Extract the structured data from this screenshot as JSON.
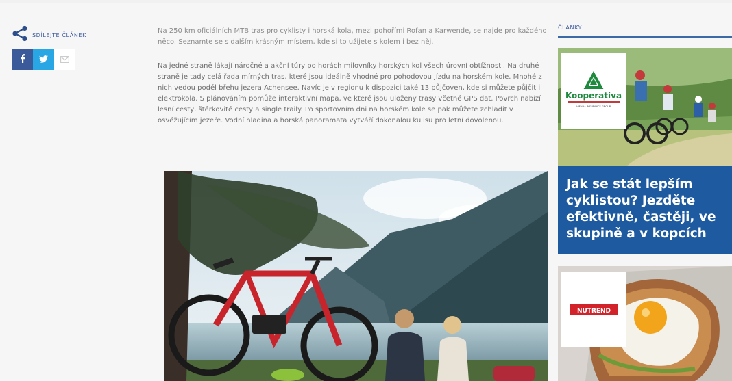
{
  "share": {
    "label": "SDÍLEJTE ČLÁNEK",
    "icons": [
      "share-icon",
      "facebook-icon",
      "twitter-icon",
      "mail-icon"
    ],
    "facebook_color": "#3b5a9a",
    "twitter_color": "#29a7e4"
  },
  "article": {
    "paragraph1": "Na 250 km oficiálních MTB tras pro cyklisty i horská kola, mezi pohořími Rofan a Karwende, se najde pro každého něco. Seznamte se s dalším krásným místem, kde si to užijete s kolem i bez něj.",
    "paragraph2": "Na jedné straně lákají náročné a akční túry po horách milovníky horských kol všech úrovní obtížnosti. Na druhé straně je tady celá řada mírných tras, které jsou ideálně vhodné pro pohodovou jízdu na horském kole. Mnohé z nich vedou podél břehu jezera Achensee. Navíc je v regionu k dispozici také 13 půjčoven, kde si můžete půjčit i elektrokola. S plánováním pomůže interaktivní mapa, ve které jsou uloženy trasy včetně GPS dat. Povrch nabízí lesní cesty, štěrkovité cesty a single traily. Po sportovním dni na horském kole se pak můžete zchladit v osvěžujícím jezeře. Vodní hladina a horská panoramata vytváří dokonalou kulisu pro letní dovolenou."
  },
  "sidebar": {
    "heading": "ČLÁNKY",
    "accent": "#1e5aa0",
    "card1": {
      "title": "Jak se stát lepším cyklistou? Jezděte efektivně, častěji, ve skupině a v kopcích",
      "sponsor": "Kooperativa",
      "sponsor_sub": "VIENNA INSURANCE GROUP"
    },
    "card2": {
      "sponsor": "NUTREND"
    }
  }
}
